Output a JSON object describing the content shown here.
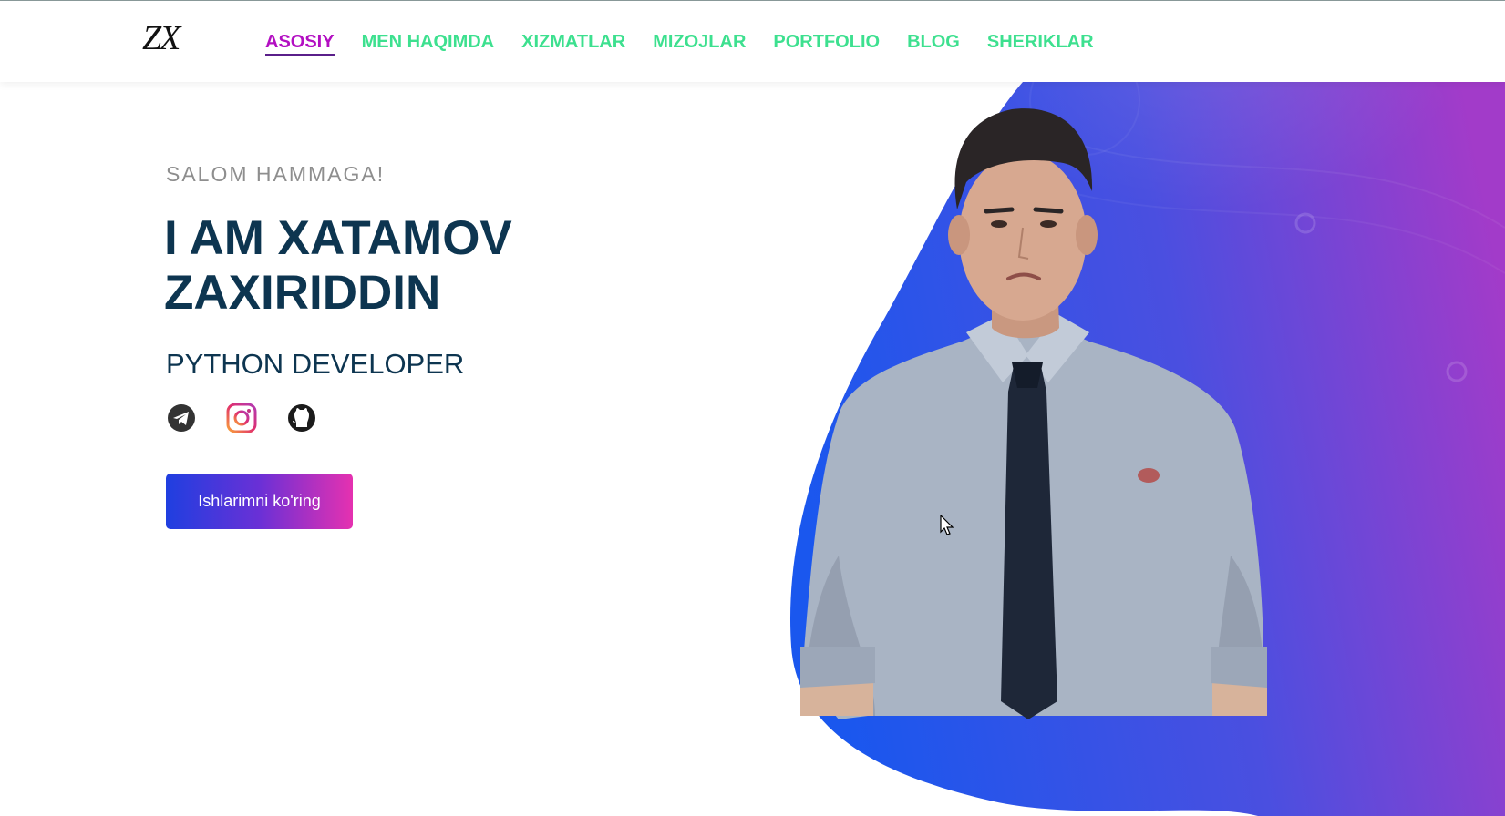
{
  "header": {
    "logo": "ZX",
    "nav": [
      {
        "label": "ASOSIY",
        "active": true
      },
      {
        "label": "MEN HAQIMDA"
      },
      {
        "label": "XIZMATLAR"
      },
      {
        "label": "MIZOJLAR"
      },
      {
        "label": "PORTFOLIO"
      },
      {
        "label": "BLOG"
      },
      {
        "label": "SHERIKLAR"
      }
    ]
  },
  "hero": {
    "greeting": "SALOM HAMMAGA!",
    "name": "I AM XATAMOV ZAXIRIDDIN",
    "role": "PYTHON DEVELOPER",
    "cta_label": "Ishlarimni ko'ring",
    "socials": [
      {
        "icon": "telegram-icon"
      },
      {
        "icon": "instagram-icon"
      },
      {
        "icon": "github-icon"
      }
    ]
  },
  "colors": {
    "nav_text": "#3de08f",
    "nav_active": "#b30fc2",
    "heading": "#0d3550",
    "blob_start": "#1f5cf0",
    "blob_end": "#a43cc8"
  }
}
